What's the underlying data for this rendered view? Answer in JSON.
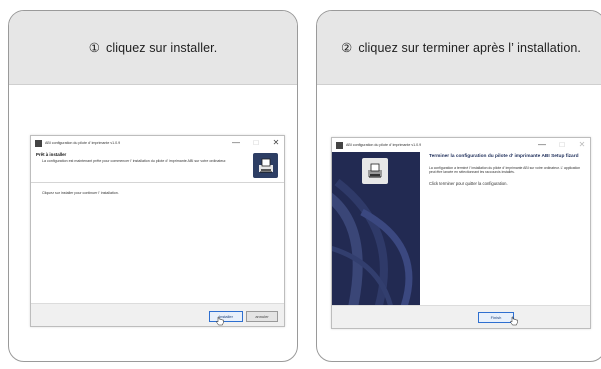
{
  "steps": [
    {
      "number": "①",
      "text": "cliquez sur installer."
    },
    {
      "number": "②",
      "text": "cliquez sur terminer après l’ installation."
    }
  ],
  "installer_window": {
    "title": "ABI configuration du pilote d’ imprimante v1.0.9",
    "heading": "Prêt à installer",
    "subheading": "La configuration est maintenant prête pour commencer l’ installation du pilote d’ imprimante ABI sur votre ordinateur.",
    "body": "Cliquez sur installer pour continuer l’ installation.",
    "install_button": "Installer",
    "cancel_button": "annuler",
    "controls": {
      "minimize": "—",
      "maximize": "□",
      "close": "✕"
    }
  },
  "finish_window": {
    "title": "ABI configuration du pilote d’ imprimante v1.0.9",
    "heading": "Terminer la configuration du pilote d’ imprimante ABI Setup fizard",
    "paragraph": "La configuration a terminé l’ installation du pilote d’ imprimante ABI sur votre ordinateur. L’ application peut être lancée en sélectionnant les raccourcis installés.",
    "instruction": "Click terminer pour quitter la configuration.",
    "finish_button": "Finish",
    "controls": {
      "minimize": "—",
      "maximize": "□",
      "close": "✕"
    }
  }
}
